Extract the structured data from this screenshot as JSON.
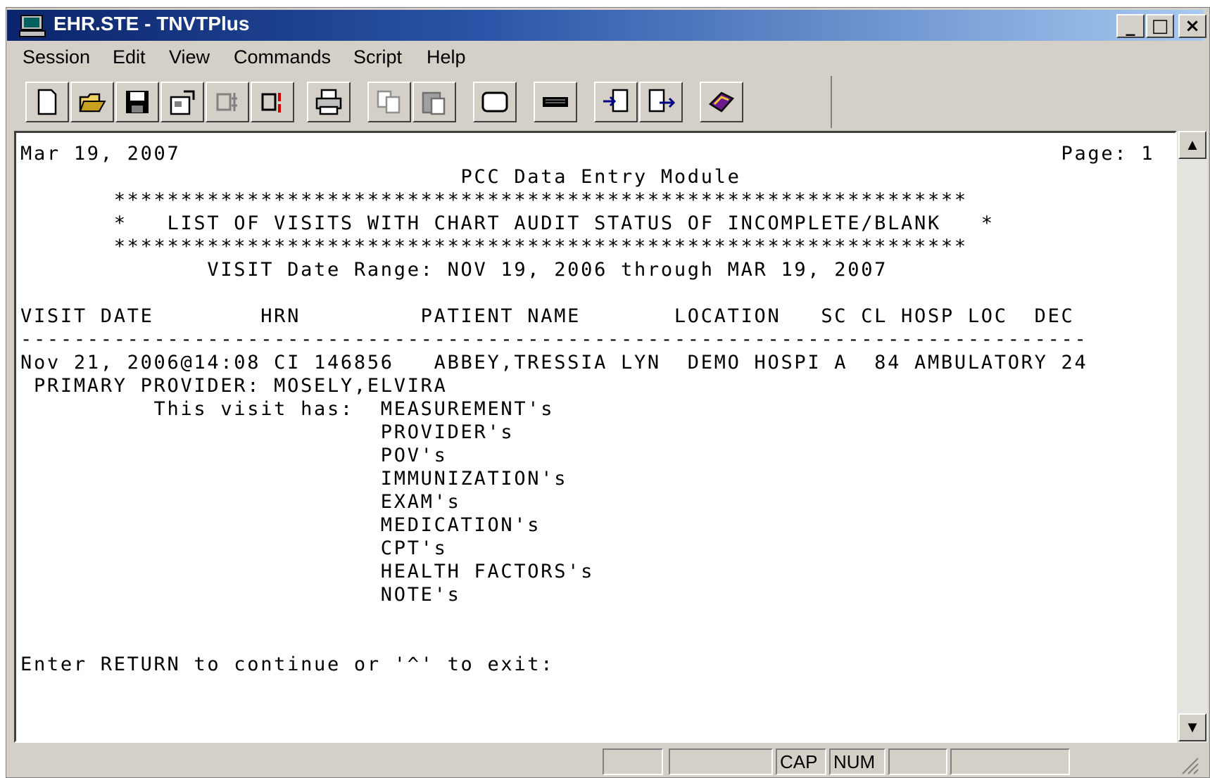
{
  "window": {
    "title": "EHR.STE - TNVTPlus",
    "minimize_label": "_",
    "maximize_label": "□",
    "close_label": "×"
  },
  "menu": [
    "Session",
    "Edit",
    "View",
    "Commands",
    "Script",
    "Help"
  ],
  "toolbar": {
    "buttons": [
      "new-icon",
      "open-icon",
      "save-icon",
      "properties-icon",
      "capture-off-icon",
      "capture-icon",
      "print-icon",
      "copy-icon",
      "paste-icon",
      "screen-icon",
      "keyboard-icon",
      "import-icon",
      "export-icon",
      "help-book-icon"
    ]
  },
  "terminal": {
    "lines": [
      "Mar 19, 2007                                                                  Page: 1",
      "                                 PCC Data Entry Module",
      "       ****************************************************************",
      "       *   LIST OF VISITS WITH CHART AUDIT STATUS OF INCOMPLETE/BLANK   *",
      "       ****************************************************************",
      "              VISIT Date Range: NOV 19, 2006 through MAR 19, 2007",
      "",
      "VISIT DATE        HRN         PATIENT NAME       LOCATION   SC CL HOSP LOC  DEC",
      "--------------------------------------------------------------------------------",
      "Nov 21, 2006@14:08 CI 146856   ABBEY,TRESSIA LYN  DEMO HOSPI A  84 AMBULATORY 24",
      " PRIMARY PROVIDER: MOSELY,ELVIRA",
      "          This visit has:  MEASUREMENT's",
      "                           PROVIDER's",
      "                           POV's",
      "                           IMMUNIZATION's",
      "                           EXAM's",
      "                           MEDICATION's",
      "                           CPT's",
      "                           HEALTH FACTORS's",
      "                           NOTE's",
      "",
      "",
      "Enter RETURN to continue or '^' to exit:"
    ]
  },
  "scrollbar": {
    "up_label": "▲",
    "down_label": "▼"
  },
  "statusbar": {
    "caps": "CAP",
    "num": "NUM"
  }
}
